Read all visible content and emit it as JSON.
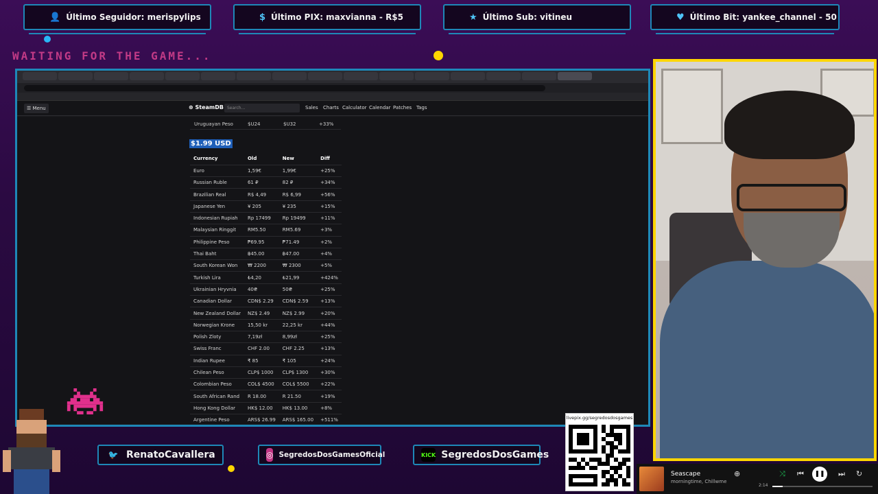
{
  "overlay": {
    "top_stats": [
      {
        "label": "Último Seguidor: merispylips",
        "icon": "person-icon"
      },
      {
        "label": "Último PIX: maxvianna - R$5",
        "icon": "dollar-icon"
      },
      {
        "label": "Último Sub: vitineu",
        "icon": "star-icon"
      },
      {
        "label": "Último Bit: yankee_channel - 50",
        "icon": "heart-icon"
      }
    ],
    "waiting_text": "WAITING FOR THE GAME..."
  },
  "steamdb": {
    "menu_label": "Menu",
    "logo": "SteamDB",
    "search_placeholder": "Search...",
    "nav": [
      "Sales",
      "Charts",
      "Calculator",
      "Calendar",
      "Patches",
      "Tags"
    ],
    "previous_row": {
      "currency": "Uruguayan Peso",
      "old": "$U24",
      "new": "$U32",
      "diff": "+33%"
    },
    "price_heading": "$1.99 USD",
    "columns": [
      "Currency",
      "Old",
      "New",
      "Diff"
    ],
    "rows": [
      [
        "Euro",
        "1,59€",
        "1,99€",
        "+25%"
      ],
      [
        "Russian Ruble",
        "61 ₽",
        "82 ₽",
        "+34%"
      ],
      [
        "Brazilian Real",
        "R$ 4,49",
        "R$ 6,99",
        "+56%"
      ],
      [
        "Japanese Yen",
        "¥ 205",
        "¥ 235",
        "+15%"
      ],
      [
        "Indonesian Rupiah",
        "Rp 17499",
        "Rp 19499",
        "+11%"
      ],
      [
        "Malaysian Ringgit",
        "RM5.50",
        "RM5.69",
        "+3%"
      ],
      [
        "Philippine Peso",
        "₱69.95",
        "₱71.49",
        "+2%"
      ],
      [
        "Thai Baht",
        "฿45.00",
        "฿47.00",
        "+4%"
      ],
      [
        "South Korean Won",
        "₩ 2200",
        "₩ 2300",
        "+5%"
      ],
      [
        "Turkish Lira",
        "₺4,20",
        "₺21,99",
        "+424%"
      ],
      [
        "Ukrainian Hryvnia",
        "40₴",
        "50₴",
        "+25%"
      ],
      [
        "Canadian Dollar",
        "CDN$ 2.29",
        "CDN$ 2.59",
        "+13%"
      ],
      [
        "New Zealand Dollar",
        "NZ$ 2.49",
        "NZ$ 2.99",
        "+20%"
      ],
      [
        "Norwegian Krone",
        "15,50 kr",
        "22,25 kr",
        "+44%"
      ],
      [
        "Polish Zloty",
        "7,19zł",
        "8,99zł",
        "+25%"
      ],
      [
        "Swiss Franc",
        "CHF 2.00",
        "CHF 2.25",
        "+13%"
      ],
      [
        "Indian Rupee",
        "₹ 85",
        "₹ 105",
        "+24%"
      ],
      [
        "Chilean Peso",
        "CLP$ 1000",
        "CLP$ 1300",
        "+30%"
      ],
      [
        "Colombian Peso",
        "COL$ 4500",
        "COL$ 5500",
        "+22%"
      ],
      [
        "South African Rand",
        "R 18.00",
        "R 21.50",
        "+19%"
      ],
      [
        "Hong Kong Dollar",
        "HK$ 12.00",
        "HK$ 13.00",
        "+8%"
      ],
      [
        "Argentine Peso",
        "ARS$ 26.99",
        "ARS$ 165.00",
        "+511%"
      ]
    ]
  },
  "socials": [
    {
      "label": "RenatoCavallera",
      "icon": "twitter-icon",
      "color": "#1da1f2"
    },
    {
      "label": "SegredosDosGamesOficial",
      "icon": "instagram-icon",
      "color": "#c13584"
    },
    {
      "label": "SegredosDosGames",
      "icon": "kick-icon",
      "color": "#53fc18"
    }
  ],
  "qr": {
    "url": "livepix.gg/segredosdosgames"
  },
  "player": {
    "song": "Seascape",
    "artist": "morningtime, Chillwme",
    "elapsed": "2:14",
    "progress": 0.1
  },
  "colors": {
    "accent": "#1e88b8",
    "cam_border": "#ffd600",
    "waiting": "#c23a86"
  }
}
